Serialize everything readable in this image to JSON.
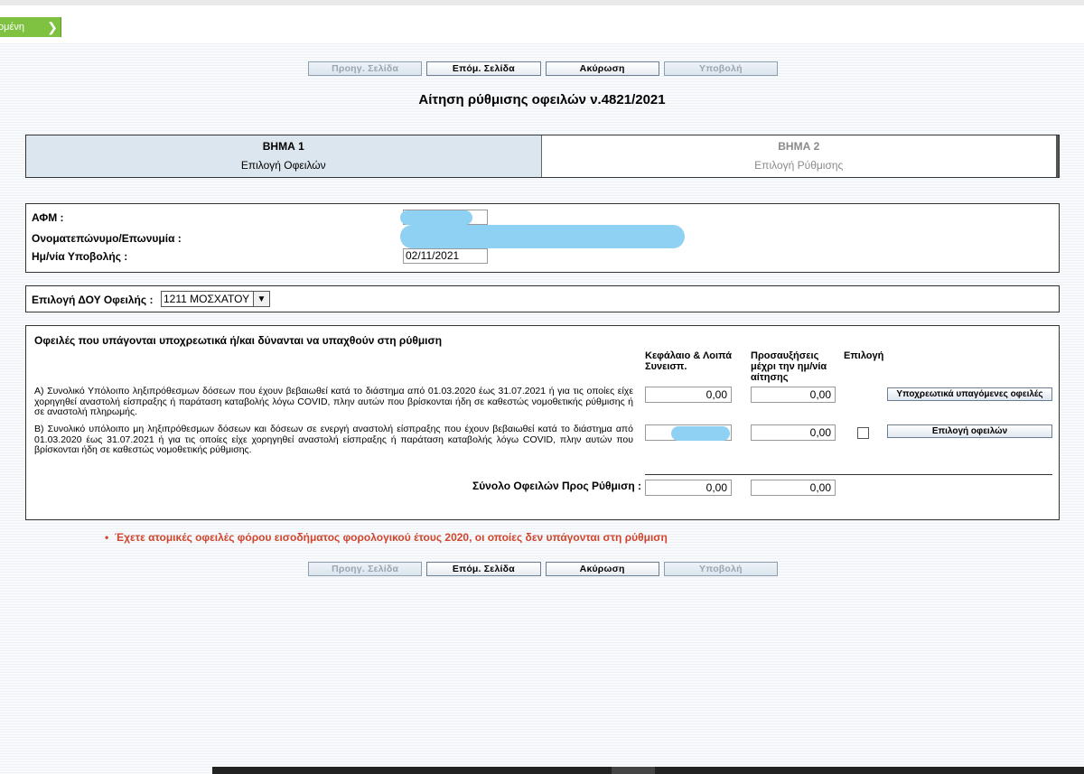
{
  "topbar": {
    "back_label": "ομένη",
    "back_arrow": "chevron-right-icon"
  },
  "nav": {
    "prev": "Προηγ. Σελίδα",
    "next": "Επόμ. Σελίδα",
    "cancel": "Ακύρωση",
    "submit": "Υποβολή"
  },
  "title": "Αίτηση ρύθμισης οφειλών ν.4821/2021",
  "steps": [
    {
      "num": "ΒΗΜΑ 1",
      "label": "Επιλογή Οφειλών"
    },
    {
      "num": "ΒΗΜΑ 2",
      "label": "Επιλογή Ρύθμισης"
    }
  ],
  "info": {
    "afm_label": "ΑΦΜ :",
    "name_label": "Ονοματεπώνυμο/Επωνυμία :",
    "date_label": "Ημ/νία Υποβολής :",
    "date_value": "02/11/2021"
  },
  "doy": {
    "label": "Επιλογή ΔΟΥ Οφειλής :",
    "selected": "1211 ΜΟΣΧΑΤΟΥ"
  },
  "debts": {
    "heading": "Οφειλές που υπάγονται υποχρεωτικά ή/και δύνανται να υπαχθούν στη ρύθμιση",
    "col_capital": "Κεφάλαιο & Λοιπά Συνεισπ.",
    "col_surcharge": "Προσαυξήσεις μέχρι την ημ/νία αίτησης",
    "col_select": "Επιλογή",
    "rows": [
      {
        "text": "Α) Συνολικό Υπόλοιπο ληξιπρόθεσμων δόσεων που έχουν βεβαιωθεί κατά το διάστημα από 01.03.2020 έως 31.07.2021 ή για τις οποίες είχε χορηγηθεί αναστολή είσπραξης ή παράταση καταβολής λόγω COVID, πλην αυτών που βρίσκονται ήδη σε καθεστώς νομοθετικής ρύθμισης ή σε αναστολή πληρωμής.",
        "capital": "0,00",
        "surcharge": "0,00",
        "button": "Υποχρεωτικά υπαγόμενες οφειλές"
      },
      {
        "text": "Β) Συνολικό υπόλοιπο μη ληξιπρόθεσμων δόσεων και δόσεων σε ενεργή αναστολή είσπραξης που έχουν βεβαιωθεί κατά το διάστημα από 01.03.2020 έως 31.07.2021 ή για τις οποίες είχε χορηγηθεί αναστολή είσπραξης ή παράταση καταβολής λόγω COVID, πλην αυτών που βρίσκονται ήδη σε καθεστώς νομοθετικής ρύθμισης.",
        "capital": "",
        "surcharge": "0,00",
        "button": "Επιλογή οφειλών"
      }
    ],
    "total_label": "Σύνολο Οφειλών Προς Ρύθμιση :",
    "total_capital": "0,00",
    "total_surcharge": "0,00"
  },
  "warning": "Έχετε ατομικές οφειλές φόρου εισοδήματος φορολογικού έτους 2020, οι οποίες δεν υπάγονται στη ρύθμιση",
  "colors": {
    "accent_green": "#7fc241",
    "warning_red": "#d0452d",
    "redaction": "#8fd1f2",
    "step_active": "#dbe6ee"
  }
}
